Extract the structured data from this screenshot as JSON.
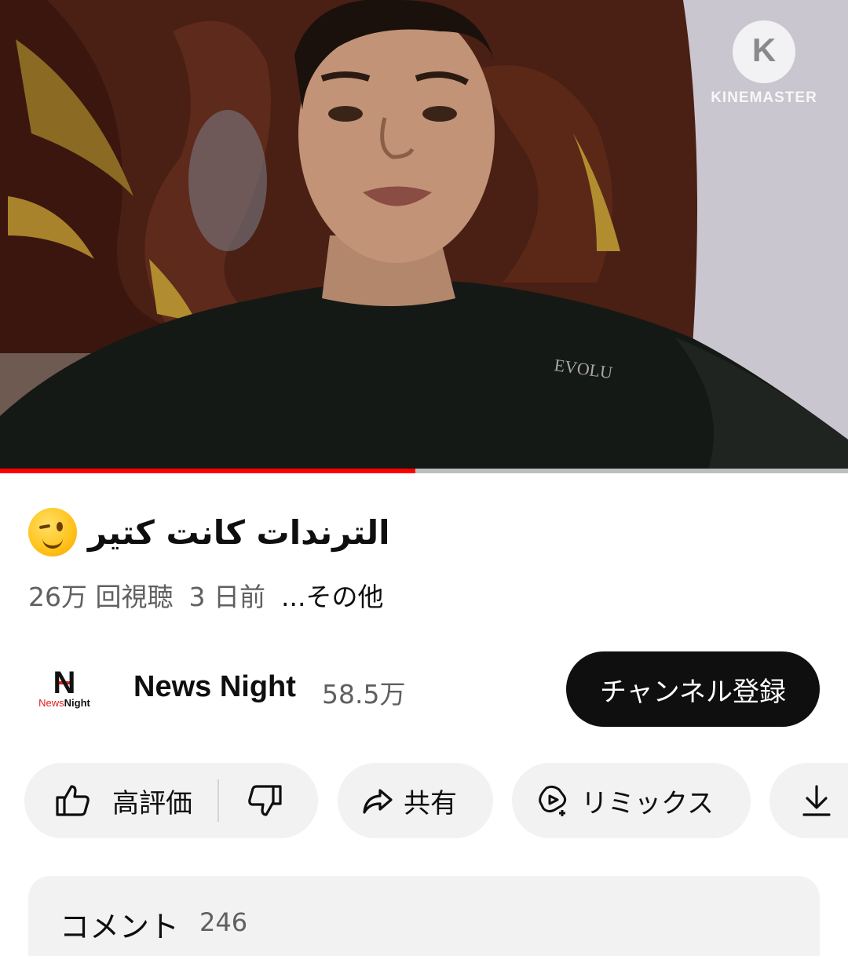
{
  "player": {
    "watermark_text": "KINEMASTER",
    "watermark_letter": "K",
    "progress_fraction": 0.49
  },
  "video": {
    "title": "الترندات كانت كتير",
    "title_emoji": "winking-face",
    "views": "26万 回視聴",
    "age": "3 日前",
    "more_label": "...その他"
  },
  "channel": {
    "logo_letter": "N",
    "logo_sub_news": "News",
    "logo_sub_night": "Night",
    "name": "News Night",
    "subscribers": "58.5万",
    "subscribe_label": "チャンネル登録"
  },
  "actions": {
    "like_label": "高評価",
    "share_label": "共有",
    "remix_label": "リミックス"
  },
  "comments": {
    "label": "コメント",
    "count": "246"
  },
  "colors": {
    "progress": "#ff0000",
    "chip_bg": "#f2f2f2",
    "subscribe_bg": "#0f0f0f",
    "secondary_text": "#606060"
  }
}
